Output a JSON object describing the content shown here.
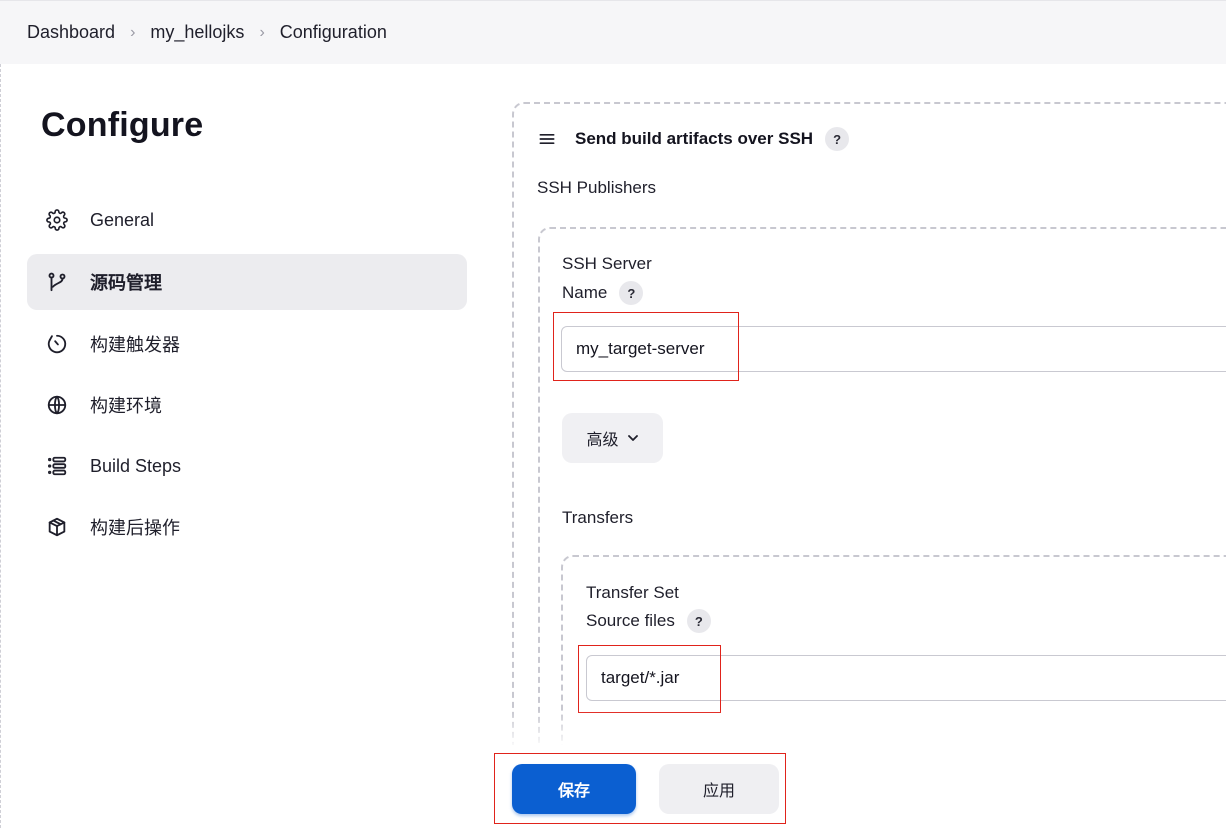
{
  "breadcrumb": {
    "items": [
      "Dashboard",
      "my_hellojks",
      "Configuration"
    ],
    "separator": "›"
  },
  "sidebar": {
    "title": "Configure",
    "items": [
      {
        "label": "General",
        "icon": "gear-icon",
        "active": false
      },
      {
        "label": "源码管理",
        "icon": "source-branch-icon",
        "active": true
      },
      {
        "label": "构建触发器",
        "icon": "timer-icon",
        "active": false
      },
      {
        "label": "构建环境",
        "icon": "globe-icon",
        "active": false
      },
      {
        "label": "Build Steps",
        "icon": "list-icon",
        "active": false
      },
      {
        "label": "构建后操作",
        "icon": "package-icon",
        "active": false
      }
    ]
  },
  "main": {
    "section_title": "Send build artifacts over SSH",
    "help": "?",
    "ssh_publishers_label": "SSH Publishers",
    "ssh_server_label": "SSH Server",
    "name_label": "Name",
    "name_value": "my_target-server",
    "advanced_label": "高级",
    "transfers_label": "Transfers",
    "transfer_set_label": "Transfer Set",
    "source_files_label": "Source files",
    "source_files_value": "target/*.jar"
  },
  "footer": {
    "save_label": "保存",
    "apply_label": "应用"
  },
  "colors": {
    "primary": "#0b5fd1",
    "highlight_annotation": "#e0231b",
    "active_nav_bg": "#ececef"
  }
}
